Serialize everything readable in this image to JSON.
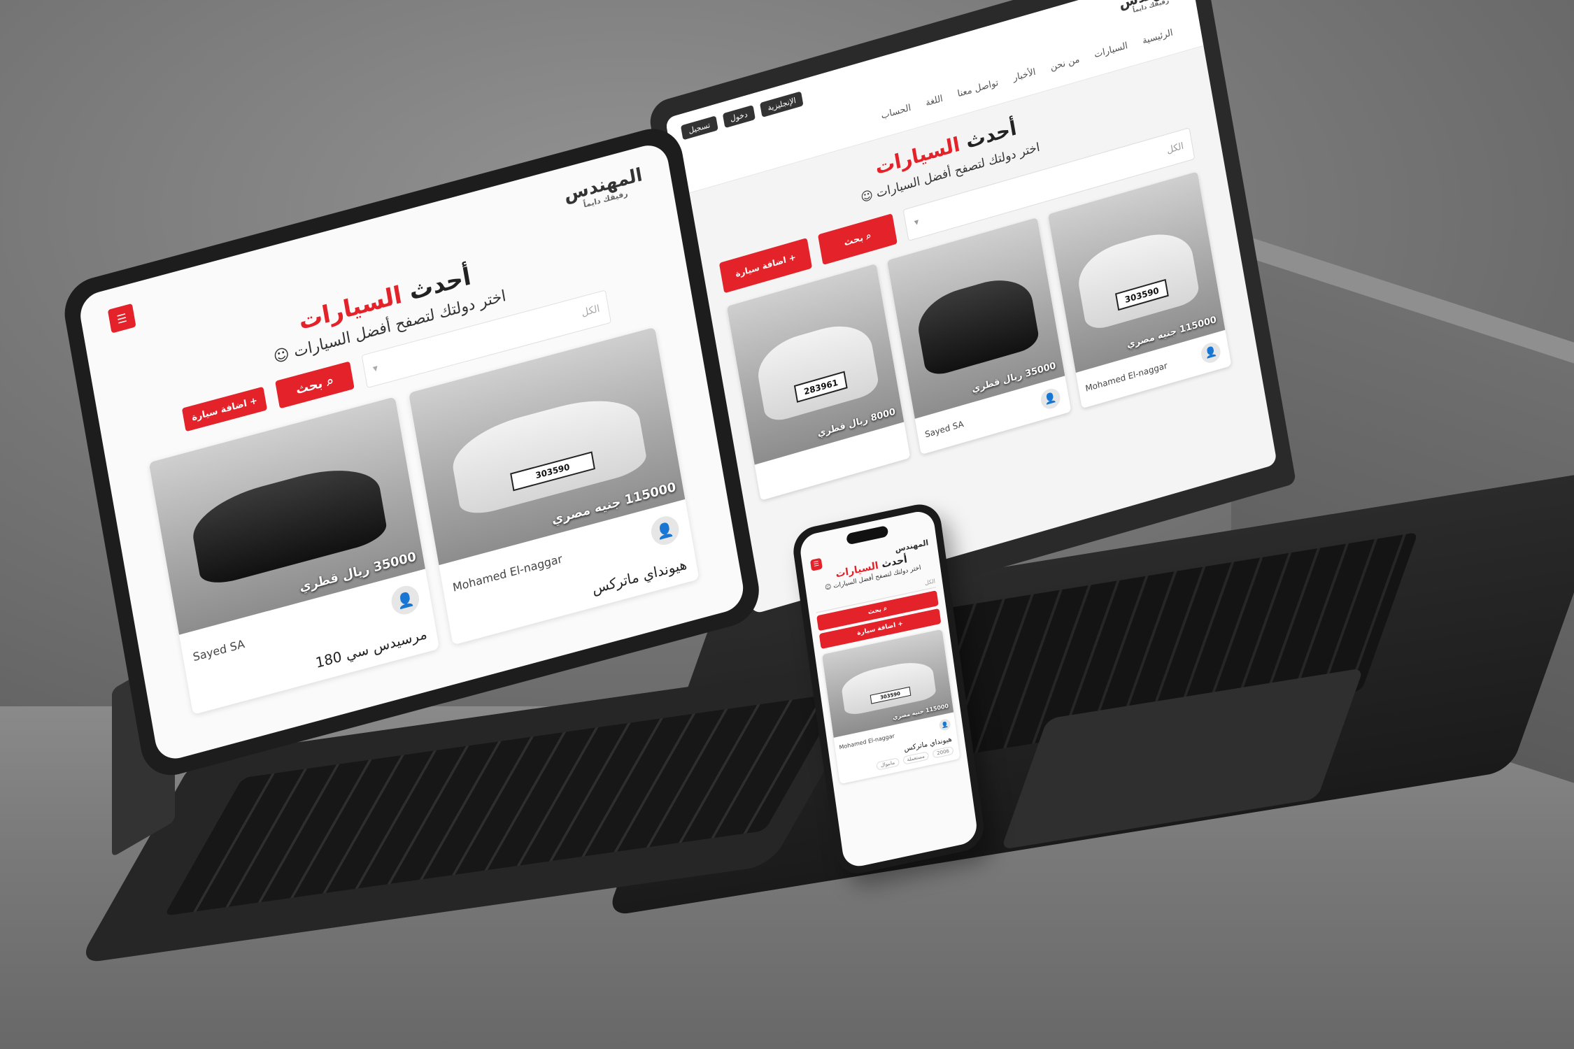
{
  "brand": {
    "logo_text": "المهندس",
    "logo_sub": "رفيقك دايماً"
  },
  "laptop": {
    "topbar": {
      "lang": "الإنجليزية",
      "login": "دخول",
      "register": "تسجيل"
    },
    "nav": [
      "الرئيسية",
      "السيارات",
      "من نحن",
      "الأخبار",
      "تواصل معنا",
      "اللغة",
      "الحساب"
    ],
    "select_placeholder": "الكل",
    "search_label": "بحث",
    "add_label": "اضافة سيارة",
    "cards": [
      {
        "price": "8000 ريال قطري",
        "plate": "283961",
        "owner": "",
        "color": "white"
      },
      {
        "price": "35000 ريال قطري",
        "plate": "",
        "owner": "Sayed SA",
        "color": "black"
      },
      {
        "price": "115000 جنيه مصري",
        "plate": "303590",
        "owner": "Mohamed El-naggar",
        "color": "white"
      }
    ]
  },
  "hero": {
    "title_a": "أحدث",
    "title_b": "السيارات",
    "subtitle": "اختر دولتك لتصفح أفضل السيارات"
  },
  "tablet": {
    "select_placeholder": "الكل",
    "search_label": "بحث",
    "add_label": "اضافة سيارة",
    "cards": [
      {
        "price": "115000 جنيه مصري",
        "plate": "303590",
        "owner": "Mohamed El-naggar",
        "name": "هيونداي ماتركس",
        "color": "white"
      },
      {
        "price": "35000 ريال قطري",
        "plate": "",
        "owner": "Sayed SA",
        "name": "مرسيدس سي 180",
        "color": "black"
      }
    ]
  },
  "phone": {
    "select_placeholder": "الكل",
    "search_label": "بحث",
    "add_label": "اضافة سيارة",
    "card": {
      "price": "115000 جنيه مصري",
      "plate": "303590",
      "owner": "Mohamed El-naggar",
      "name": "هيونداي ماتركس",
      "tags": [
        "2006",
        "مستعملة",
        "مانيوال"
      ]
    }
  },
  "colors": {
    "accent": "#e3222a",
    "device": "#1d1d1d"
  }
}
